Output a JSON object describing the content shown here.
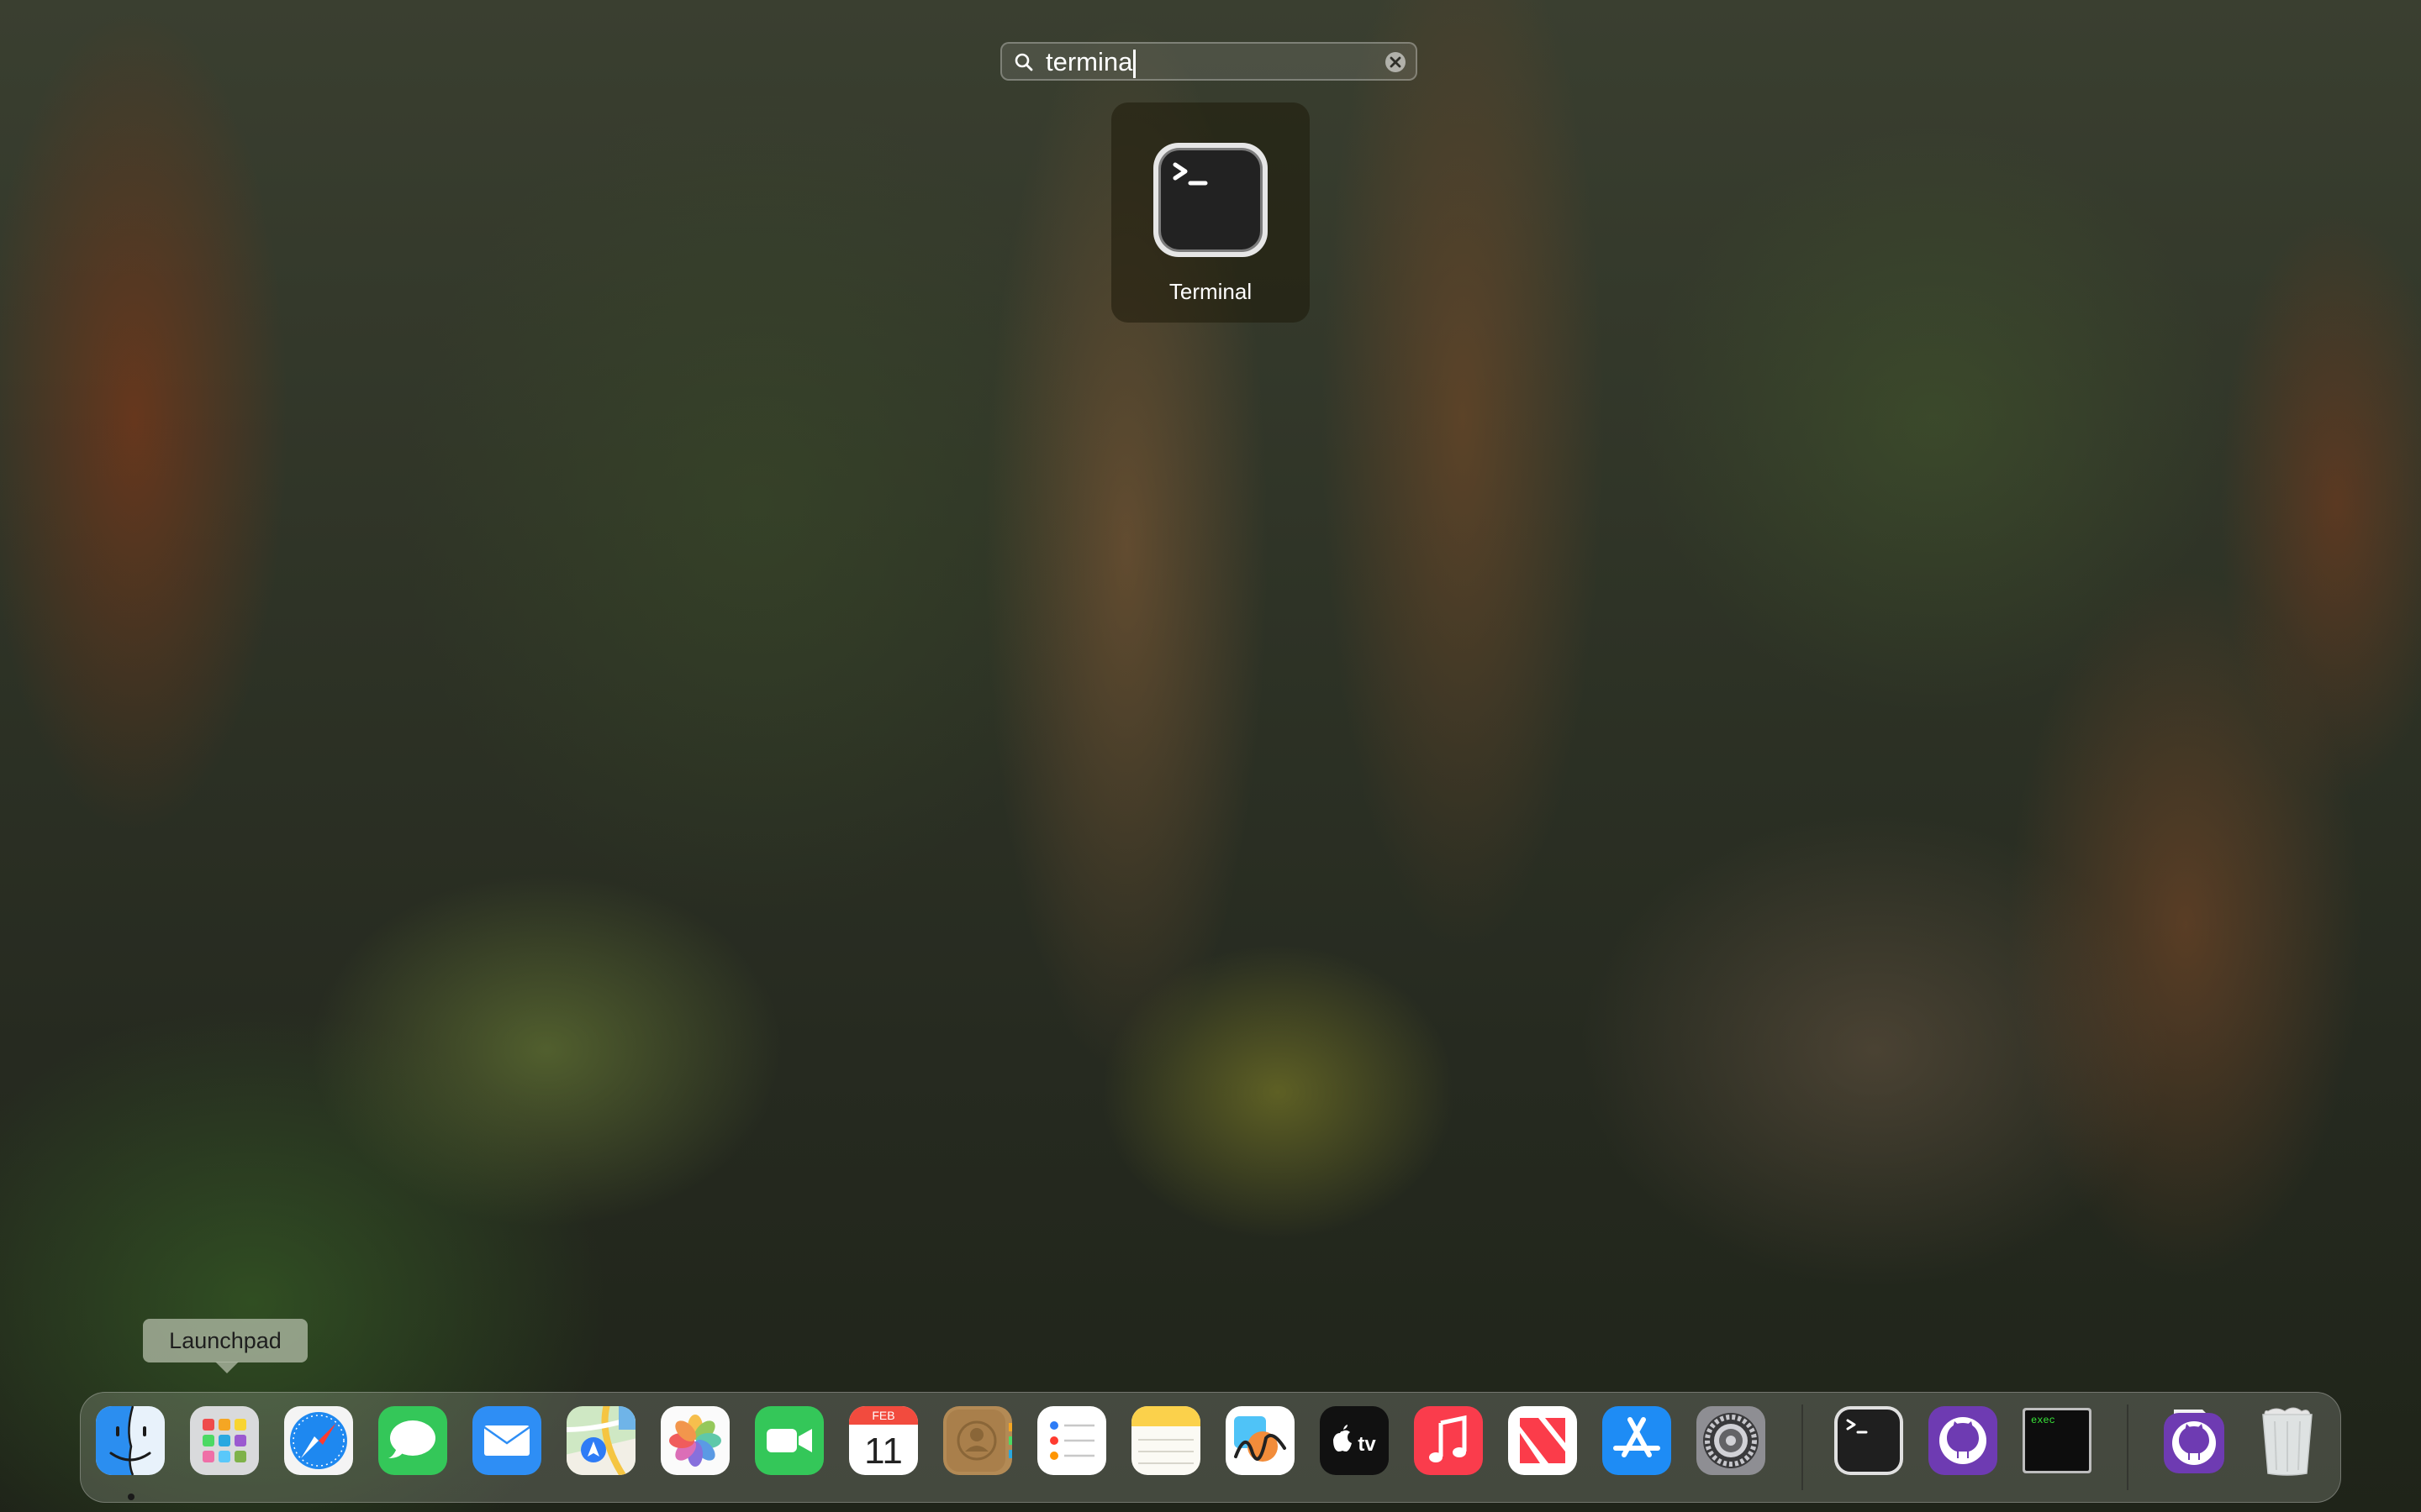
{
  "search": {
    "query": "termina"
  },
  "results": [
    {
      "label": "Terminal",
      "icon": "terminal-icon"
    }
  ],
  "tooltip": {
    "text": "Launchpad"
  },
  "calendar": {
    "month": "FEB",
    "day": "11"
  },
  "dock": {
    "apps": [
      {
        "name": "Finder",
        "icon": "finder-icon",
        "running": true
      },
      {
        "name": "Launchpad",
        "icon": "launchpad-icon"
      },
      {
        "name": "Safari",
        "icon": "safari-icon"
      },
      {
        "name": "Messages",
        "icon": "messages-icon"
      },
      {
        "name": "Mail",
        "icon": "mail-icon"
      },
      {
        "name": "Maps",
        "icon": "maps-icon"
      },
      {
        "name": "Photos",
        "icon": "photos-icon"
      },
      {
        "name": "FaceTime",
        "icon": "facetime-icon"
      },
      {
        "name": "Calendar",
        "icon": "calendar-icon"
      },
      {
        "name": "Contacts",
        "icon": "contacts-icon"
      },
      {
        "name": "Reminders",
        "icon": "reminders-icon"
      },
      {
        "name": "Notes",
        "icon": "notes-icon"
      },
      {
        "name": "Freeform",
        "icon": "freeform-icon"
      },
      {
        "name": "TV",
        "icon": "apple-tv-icon"
      },
      {
        "name": "Music",
        "icon": "music-icon"
      },
      {
        "name": "News",
        "icon": "news-icon"
      },
      {
        "name": "App Store",
        "icon": "app-store-icon"
      },
      {
        "name": "System Settings",
        "icon": "system-settings-icon"
      },
      {
        "name": "Terminal",
        "icon": "terminal-icon"
      },
      {
        "name": "GitHub Desktop",
        "icon": "github-icon"
      },
      {
        "name": "exec",
        "icon": "exec-terminal-icon"
      },
      {
        "name": "GitHub Desktop",
        "icon": "github-folder-icon"
      },
      {
        "name": "Trash",
        "icon": "trash-icon"
      }
    ],
    "tv_label": "tv",
    "exec_label": "exec"
  },
  "colors": {
    "accent_blue": "#1e88f0",
    "facetime_green": "#34c759",
    "music_red": "#fa3c4c",
    "github_purple": "#6e3bb2"
  }
}
